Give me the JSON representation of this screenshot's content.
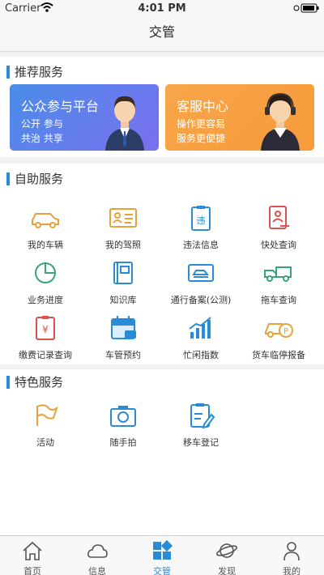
{
  "status": {
    "carrier": "Carrier",
    "time": "4:01 PM"
  },
  "nav": {
    "title": "交管"
  },
  "recommended": {
    "title": "推荐服务",
    "cards": [
      {
        "title": "公众参与平台",
        "line1": "公开 参与",
        "line2": "共治 共享"
      },
      {
        "title": "客服中心",
        "line1": "操作更容易",
        "line2": "服务更便捷"
      }
    ]
  },
  "self_service": {
    "title": "自助服务",
    "items": [
      {
        "label": "我的车辆",
        "icon": "car-icon"
      },
      {
        "label": "我的驾照",
        "icon": "license-icon"
      },
      {
        "label": "违法信息",
        "icon": "violation-icon"
      },
      {
        "label": "快处查询",
        "icon": "quick-query-icon"
      },
      {
        "label": "业务进度",
        "icon": "progress-icon"
      },
      {
        "label": "知识库",
        "icon": "knowledge-icon"
      },
      {
        "label": "通行备案(公测)",
        "icon": "pass-record-icon"
      },
      {
        "label": "拖车查询",
        "icon": "tow-truck-icon"
      },
      {
        "label": "缴费记录查询",
        "icon": "payment-icon"
      },
      {
        "label": "车管预约",
        "icon": "appointment-icon"
      },
      {
        "label": "忙闲指数",
        "icon": "busy-index-icon"
      },
      {
        "label": "货车临停报备",
        "icon": "truck-parking-icon"
      }
    ]
  },
  "featured": {
    "title": "特色服务",
    "items": [
      {
        "label": "活动",
        "icon": "flag-icon"
      },
      {
        "label": "随手拍",
        "icon": "camera-icon"
      },
      {
        "label": "移车登记",
        "icon": "move-car-icon"
      }
    ]
  },
  "tabs": [
    {
      "label": "首页",
      "icon": "home-icon"
    },
    {
      "label": "信息",
      "icon": "cloud-icon"
    },
    {
      "label": "交管",
      "icon": "grid-icon"
    },
    {
      "label": "发现",
      "icon": "planet-icon"
    },
    {
      "label": "我的",
      "icon": "person-icon"
    }
  ],
  "colors": {
    "accent": "#2a8bd6",
    "orange": "#f0a23a",
    "red": "#d9534f",
    "green": "#3aa37a"
  }
}
